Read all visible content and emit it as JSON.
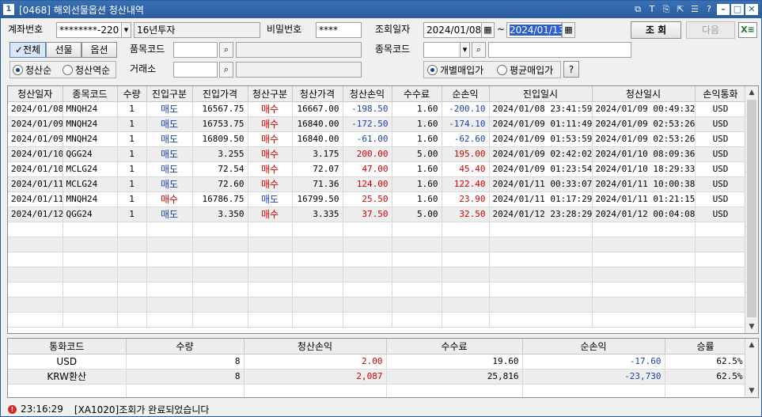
{
  "window": {
    "number": "1",
    "title": "[0468] 해외선물옵션 청산내역"
  },
  "search": {
    "account_label": "계좌번호",
    "account_value": "********-220",
    "account_name": "16년투자",
    "password_label": "비밀번호",
    "password_value": "****",
    "date_label": "조회일자",
    "date_from": "2024/01/08",
    "date_sep": "~",
    "date_to": "2024/01/13",
    "query_button": "조 회",
    "next_button": "다음",
    "product_code_label": "품목코드",
    "item_code_label": "종목코드",
    "exchange_label": "거래소",
    "segments": [
      "전체",
      "선물",
      "옵션"
    ],
    "sort_options": [
      "청산순",
      "청산역순"
    ],
    "price_options": [
      "개별매입가",
      "평균매입가"
    ],
    "help_button": "?"
  },
  "main_table": {
    "headers": [
      "청산일자",
      "종목코드",
      "수량",
      "진입구분",
      "진입가격",
      "청산구분",
      "청산가격",
      "청산손익",
      "수수료",
      "순손익",
      "진입일시",
      "청산일시",
      "손익통화"
    ],
    "rows": [
      [
        "2024/01/08",
        "MNQH24",
        "1",
        "매도",
        "16567.75",
        "매수",
        "16667.00",
        "-198.50",
        "1.60",
        "-200.10",
        "2024/01/08 23:41:59",
        "2024/01/09 00:49:32",
        "USD"
      ],
      [
        "2024/01/09",
        "MNQH24",
        "1",
        "매도",
        "16753.75",
        "매수",
        "16840.00",
        "-172.50",
        "1.60",
        "-174.10",
        "2024/01/09 01:11:49",
        "2024/01/09 02:53:26",
        "USD"
      ],
      [
        "2024/01/09",
        "MNQH24",
        "1",
        "매도",
        "16809.50",
        "매수",
        "16840.00",
        "-61.00",
        "1.60",
        "-62.60",
        "2024/01/09 01:53:59",
        "2024/01/09 02:53:26",
        "USD"
      ],
      [
        "2024/01/10",
        "QGG24",
        "1",
        "매도",
        "3.255",
        "매수",
        "3.175",
        "200.00",
        "5.00",
        "195.00",
        "2024/01/09 02:42:02",
        "2024/01/10 08:09:36",
        "USD"
      ],
      [
        "2024/01/10",
        "MCLG24",
        "1",
        "매도",
        "72.54",
        "매수",
        "72.07",
        "47.00",
        "1.60",
        "45.40",
        "2024/01/09 01:23:54",
        "2024/01/10 18:29:33",
        "USD"
      ],
      [
        "2024/01/11",
        "MCLG24",
        "1",
        "매도",
        "72.60",
        "매수",
        "71.36",
        "124.00",
        "1.60",
        "122.40",
        "2024/01/11 00:33:07",
        "2024/01/11 10:00:38",
        "USD"
      ],
      [
        "2024/01/11",
        "MNQH24",
        "1",
        "매수",
        "16786.75",
        "매도",
        "16799.50",
        "25.50",
        "1.60",
        "23.90",
        "2024/01/11 01:17:29",
        "2024/01/11 01:21:15",
        "USD"
      ],
      [
        "2024/01/12",
        "QGG24",
        "1",
        "매도",
        "3.350",
        "매수",
        "3.335",
        "37.50",
        "5.00",
        "32.50",
        "2024/01/12 23:28:29",
        "2024/01/12 00:04:08",
        "USD"
      ]
    ]
  },
  "summary_table": {
    "headers": [
      "통화코드",
      "수량",
      "청산손익",
      "수수료",
      "순손익",
      "승률"
    ],
    "rows": [
      [
        "USD",
        "8",
        "2.00",
        "19.60",
        "-17.60",
        "62.5%"
      ],
      [
        "KRW환산",
        "8",
        "2,087",
        "25,816",
        "-23,730",
        "62.5%"
      ]
    ]
  },
  "status": {
    "time": "23:16:29",
    "message": "[XA1020]조회가 완료되었습니다"
  },
  "colors": {
    "titlebar": "#2a5d9e",
    "buy": "#d00000",
    "sell": "#1a3fb0"
  }
}
